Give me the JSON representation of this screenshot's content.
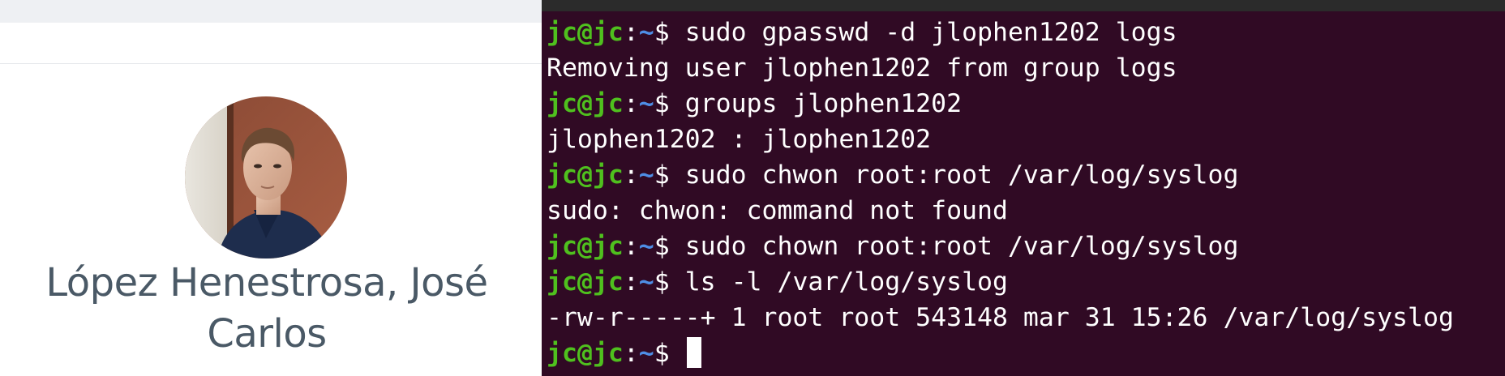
{
  "browser": {
    "profile": {
      "name_line1": "López Henestrosa, José",
      "name_line2": "Carlos"
    }
  },
  "terminal": {
    "prompt": {
      "user_host": "jc@jc",
      "colon": ":",
      "path": "~",
      "dollar": "$ "
    },
    "lines": [
      {
        "type": "cmd",
        "text": "sudo gpasswd -d jlophen1202 logs"
      },
      {
        "type": "out",
        "text": "Removing user jlophen1202 from group logs"
      },
      {
        "type": "cmd",
        "text": "groups jlophen1202"
      },
      {
        "type": "out",
        "text": "jlophen1202 : jlophen1202"
      },
      {
        "type": "cmd",
        "text": "sudo chwon root:root /var/log/syslog"
      },
      {
        "type": "out",
        "text": "sudo: chwon: command not found"
      },
      {
        "type": "cmd",
        "text": "sudo chown root:root /var/log/syslog"
      },
      {
        "type": "cmd",
        "text": "ls -l /var/log/syslog"
      },
      {
        "type": "out",
        "text": "-rw-r-----+ 1 root root 543148 mar 31 15:26 /var/log/syslog"
      },
      {
        "type": "cmd",
        "text": ""
      }
    ]
  },
  "colors": {
    "terminal_bg": "#300a24",
    "prompt_user": "#4fc01e",
    "prompt_path": "#4e8ee6",
    "name_text": "#4a5966"
  }
}
